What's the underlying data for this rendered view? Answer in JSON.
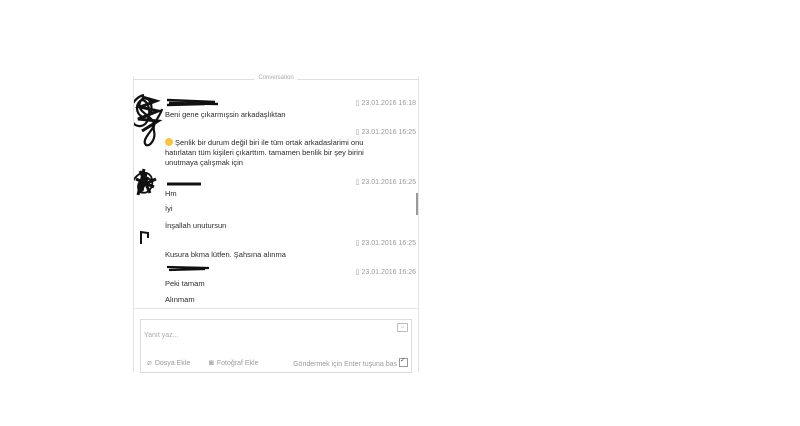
{
  "conversation": {
    "date_divider": "Conversation",
    "messages": [
      {
        "text": "Beni gene çıkarmışsin arkadaşlıktan",
        "timestamp": "23.01.2016 16:18"
      },
      {
        "text": "Şenlik bir durum değil biri ile tüm ortak arkadaslarimi onu",
        "text2": "hatırlatan tüm kişileri çıkarttım. tamamen benlik bir şey birini",
        "text3": "unutmaya çalışmak için",
        "timestamp": "23.01.2016 16:25"
      },
      {
        "text": "Hm",
        "timestamp": "23.01.2016 16:25"
      },
      {
        "text": "İyi"
      },
      {
        "text": "İnşallah unutursun"
      },
      {
        "text": "Kusura bkma lütfen. Şahsına alınma",
        "timestamp": "23.01.2016 16:25"
      },
      {
        "text": "Peki tamam",
        "timestamp": "23.01.2016 16:26"
      },
      {
        "text": "Alınmam"
      }
    ]
  },
  "composer": {
    "placeholder": "Yanıt yaz...",
    "attach_label": "Dosya Ekle",
    "photo_label": "Fotoğraf Ekle",
    "enter_label": "Göndermek için Enter tuşuna bas",
    "enter_checked": true
  },
  "icons": {
    "phone": "phone-icon",
    "attach": "paperclip-icon",
    "photo": "camera-icon",
    "emoji": "emoji-icon"
  }
}
